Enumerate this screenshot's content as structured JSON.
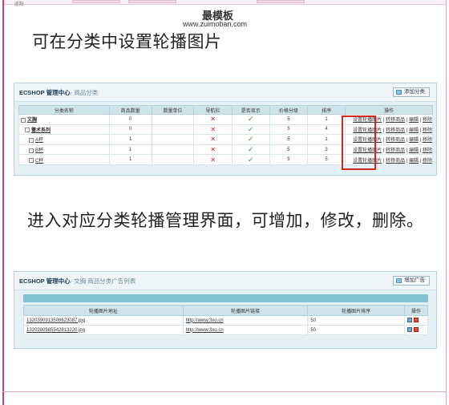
{
  "top_fragment": "·  道阳",
  "watermark": {
    "cn": "最模板",
    "url": "www.zuimoban.com"
  },
  "headings": {
    "first": "可在分类中设置轮播图片",
    "second": "进入对应分类轮播管理界面，可增加，修改，删除。"
  },
  "panel1": {
    "title": "ECSHOP 管理中心",
    "subtitle": "- 商品分类",
    "button": "添加分类",
    "columns": [
      "分类名称",
      "商品数量",
      "数量单位",
      "导航栏",
      "是否显示",
      "价格分级",
      "排序",
      "操作"
    ],
    "rows": [
      {
        "expand": "-",
        "name": "文胸",
        "bold": true,
        "count": "0",
        "unit": "",
        "nav": "✕",
        "show": "✓",
        "price": "5",
        "sort": "1"
      },
      {
        "expand": "-",
        "name": "蕾术系列",
        "bold": true,
        "count": "0",
        "unit": "",
        "nav": "✕",
        "show": "✓",
        "price": "5",
        "sort": "4"
      },
      {
        "expand": "-",
        "name": "A杯",
        "bold": false,
        "count": "1",
        "unit": "",
        "nav": "✕",
        "show": "✓",
        "price": "5",
        "sort": "1"
      },
      {
        "expand": "-",
        "name": "B杯",
        "bold": false,
        "count": "1",
        "unit": "",
        "nav": "✕",
        "show": "✓",
        "price": "5",
        "sort": "3"
      },
      {
        "expand": "-",
        "name": "C杯",
        "bold": false,
        "count": "1",
        "unit": "",
        "nav": "✕",
        "show": "✓",
        "price": "5",
        "sort": "5"
      }
    ],
    "ops": {
      "banner": "设置轮播图片",
      "move": "转移商品",
      "edit": "编辑",
      "remove": "移除",
      "sep": " | "
    }
  },
  "panel2": {
    "title": "ECSHOP 管理中心",
    "subtitle": "- 文胸 商品分类广告列表",
    "button": "增加广告",
    "columns": [
      "轮播图片地址",
      "轮播图片链接",
      "轮播图片排序",
      "操作"
    ],
    "rows": [
      {
        "image": "1320390913508623087.jpg",
        "link": "http://www.3xo.cn",
        "sort": "50"
      },
      {
        "image": "1320390985542813220.jpg",
        "link": "http://www.3xo.cn",
        "sort": "50"
      }
    ]
  },
  "icons": {
    "nav_no": "x-mark-icon",
    "show_yes": "check-icon",
    "edit": "edit-icon",
    "delete": "delete-icon",
    "add": "add-icon"
  },
  "colors": {
    "frame": "#c0428a",
    "panel_bg": "#e3f0f5",
    "header_cell": "#cfe3ec",
    "band": "#84c2d6",
    "highlight": "#d02a1a",
    "x_red": "#d32020",
    "check_green": "#2e8b3a"
  }
}
